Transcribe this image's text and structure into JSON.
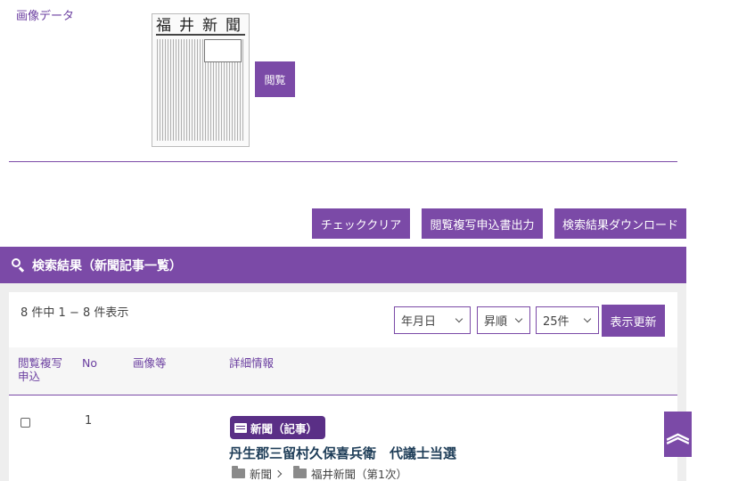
{
  "image_section": {
    "label": "画像データ",
    "masthead": "福井新聞",
    "view_button": "閲覧"
  },
  "toolbar": {
    "check_clear": "チェッククリア",
    "print_request": "閲覧複写申込書出力",
    "download": "検索結果ダウンロード"
  },
  "results": {
    "title": "検索結果（新聞記事一覧）",
    "count_text": "8 件中 1 − 8 件表示",
    "sort_select": "年月日",
    "order_select": "昇順",
    "per_page_select": "25件",
    "update_button": "表示更新",
    "columns": {
      "check": "閲覧複写申込",
      "no": "No",
      "image": "画像等",
      "detail": "詳細情報"
    },
    "rows": [
      {
        "no": "1",
        "badge": "新聞（記事）",
        "title": "丹生郡三留村久保喜兵衛　代議士当選",
        "category": "新聞",
        "publication": "福井新聞（第1次）"
      }
    ]
  },
  "colors": {
    "accent": "#7b4aa7",
    "badge": "#5a2f86",
    "title": "#1e3d58"
  },
  "icons": {
    "search": "search-icon",
    "newspaper": "newspaper-icon",
    "folder": "folder-icon",
    "scroll_top": "double-chevron-up-icon"
  },
  "scroll_top_glyph": "︽"
}
